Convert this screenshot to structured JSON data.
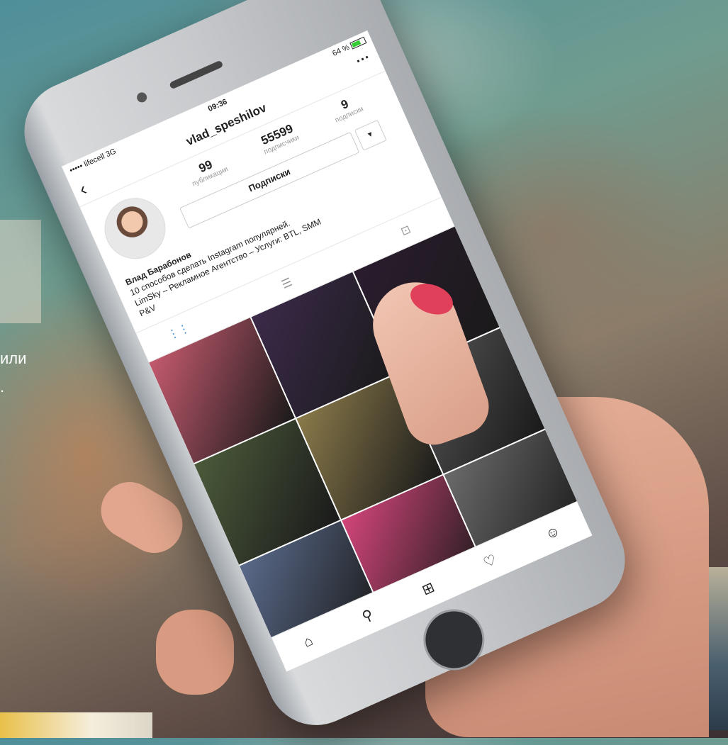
{
  "background": {
    "side_text_line1": "или",
    "side_text_line2": "."
  },
  "status_bar": {
    "carrier": "••••• lifecell  3G",
    "time": "09:36",
    "battery": "64 %"
  },
  "header": {
    "back_icon": "chevron-left-icon",
    "username": "vlad_speshilov",
    "more_icon": "ellipsis-icon"
  },
  "profile": {
    "posts_count": "99",
    "posts_label": "публикации",
    "followers_count": "55599",
    "followers_label": "подписчики",
    "following_count": "9",
    "following_label": "подписки",
    "follow_button_label": "Подписки",
    "dropdown_icon": "triangle-down-icon"
  },
  "bio": {
    "name": "Влад Барабонов",
    "line1": "10 способов сделать Instagram популярней.",
    "line2": "LimSky – Рекламное Агентство – Услуги: BTL, SMM",
    "line3": "P&V"
  },
  "tabs": {
    "grid_icon": "grid-icon",
    "list_icon": "list-icon",
    "tagged_icon": "tagged-person-icon"
  },
  "photos": [
    {
      "color": "#c45a6e"
    },
    {
      "color": "#3b2a4a"
    },
    {
      "color": "#2a1c2e"
    },
    {
      "color": "#4b5a3a"
    },
    {
      "color": "#8a7a4a"
    },
    {
      "color": "#5a5a5a"
    },
    {
      "color": "#5a6a8a"
    },
    {
      "color": "#d2457a"
    },
    {
      "color": "#6a6a6a"
    }
  ],
  "bottom_nav": {
    "home_icon": "home-icon",
    "search_icon": "search-icon",
    "add_icon": "add-post-icon",
    "heart_icon": "heart-icon",
    "profile_icon": "profile-icon"
  }
}
